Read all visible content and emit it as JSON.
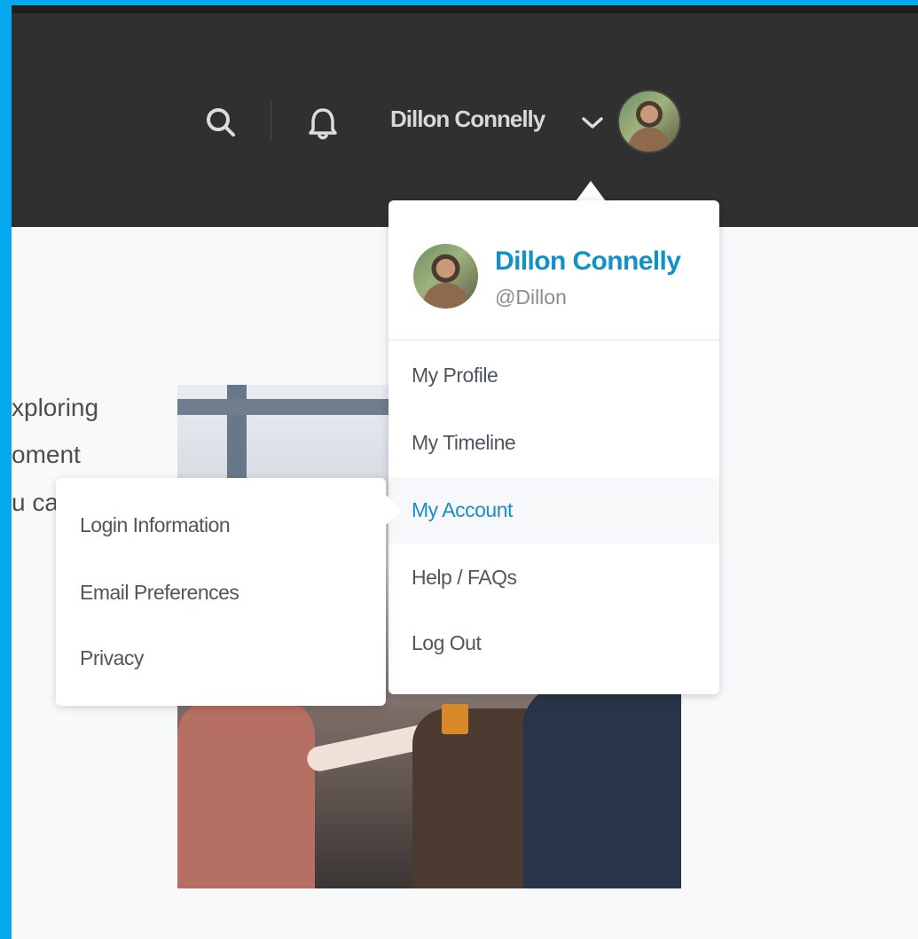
{
  "header": {
    "user_name": "Dillon Connelly",
    "icons": [
      "search-icon",
      "bell-icon",
      "chevron-down-icon",
      "avatar"
    ]
  },
  "content": {
    "partial_lines": [
      "xploring",
      "oment",
      "u ca"
    ]
  },
  "user_menu": {
    "name": "Dillon Connelly",
    "handle": "@Dillon",
    "items": [
      {
        "label": "My Profile"
      },
      {
        "label": "My Timeline"
      },
      {
        "label": "My Account"
      },
      {
        "label": "Help / FAQs"
      },
      {
        "label": "Log Out"
      }
    ]
  },
  "account_submenu": {
    "items": [
      {
        "label": "Login Information"
      },
      {
        "label": "Email Preferences"
      },
      {
        "label": "Privacy"
      }
    ]
  },
  "colors": {
    "accent": "#1290c8",
    "header_bg": "#303030",
    "border": "#05aaee"
  }
}
